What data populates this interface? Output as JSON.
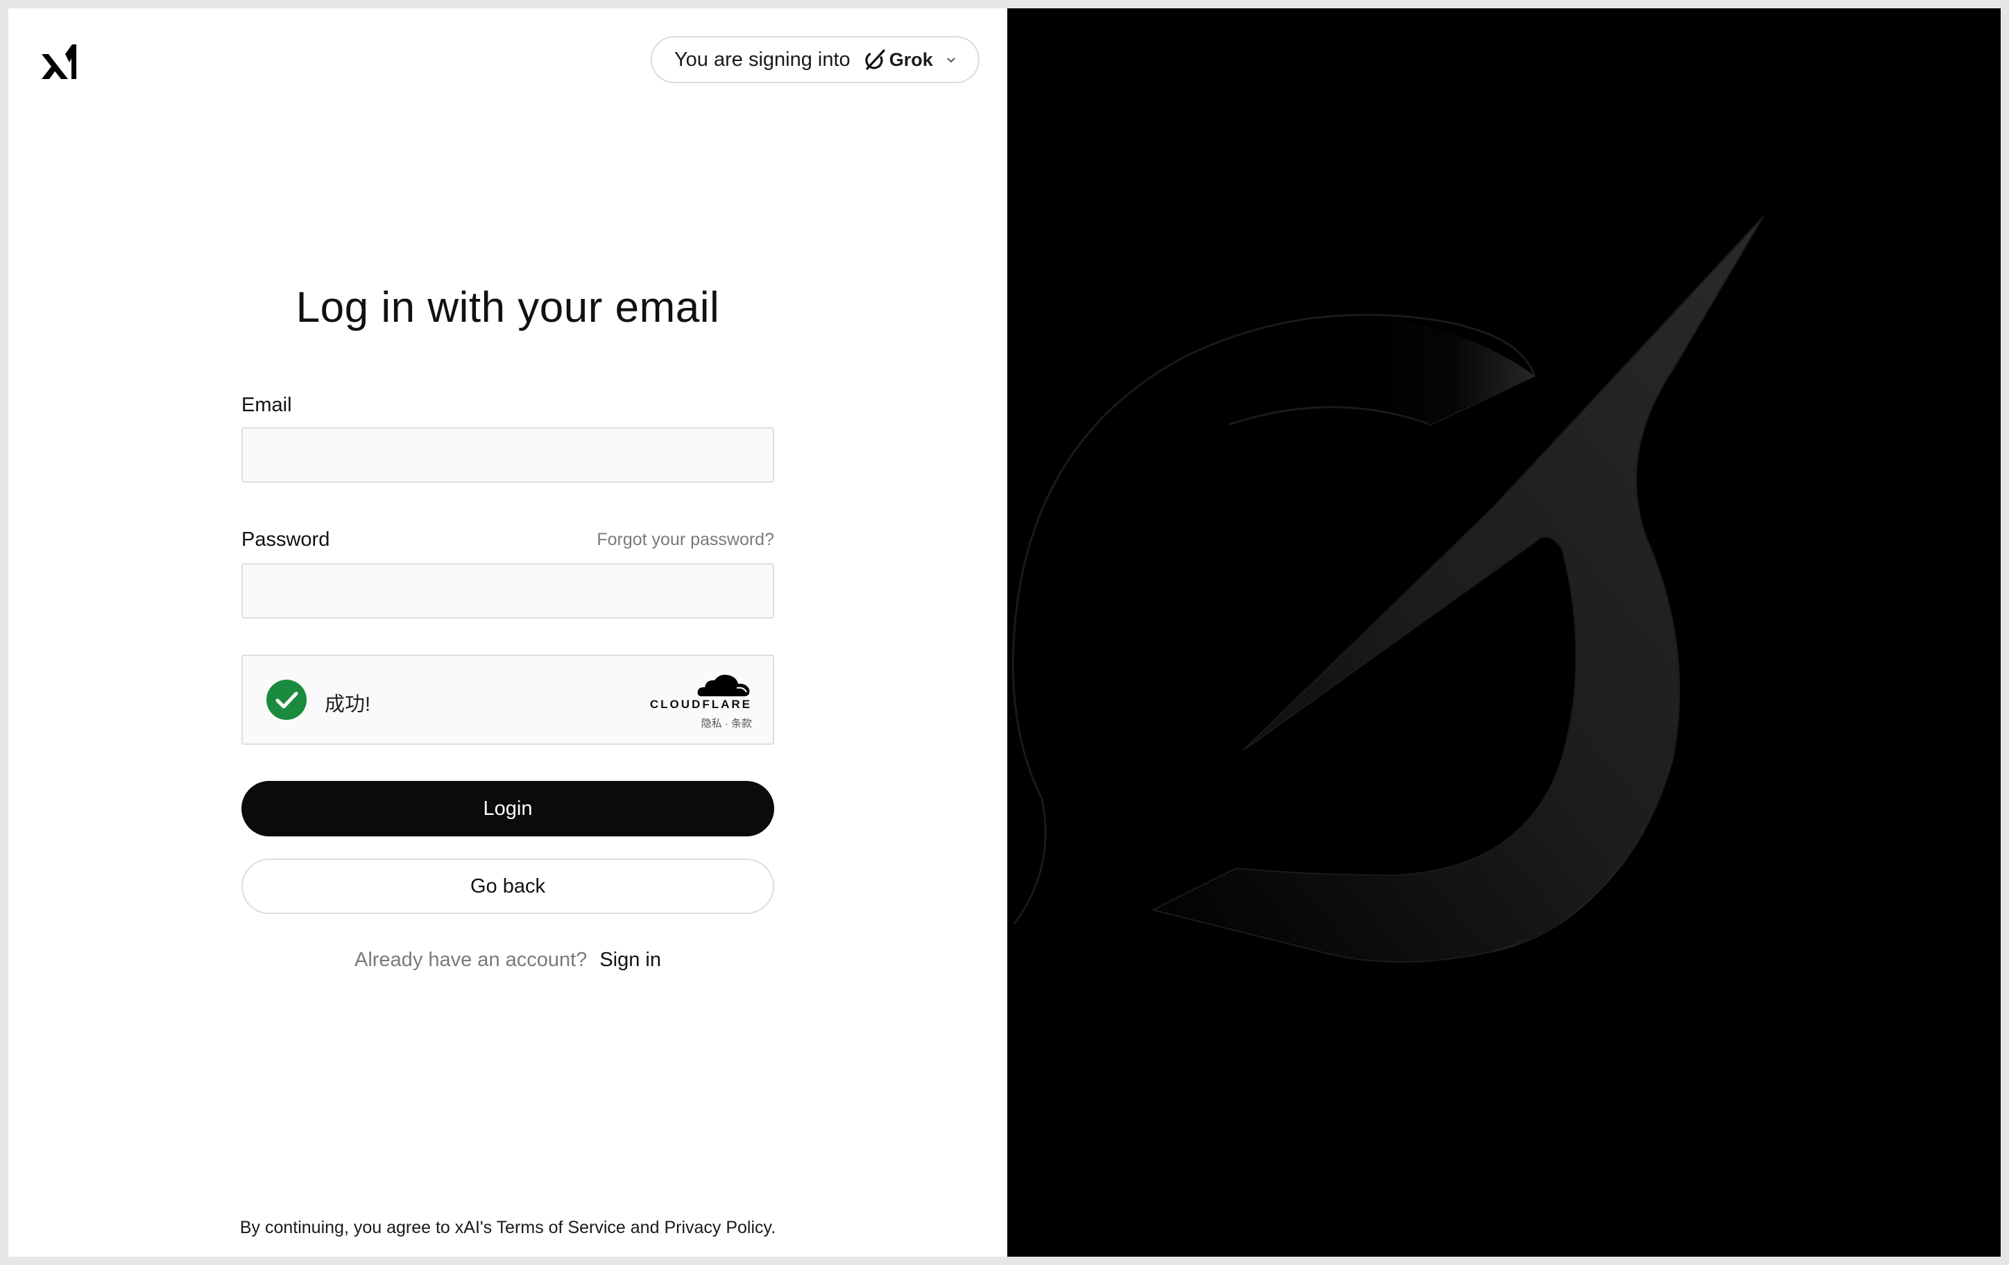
{
  "header": {
    "logo": "xai-logo",
    "signing_prefix": "You are signing into",
    "product_name": "Grok",
    "product_icon": "grok-icon",
    "dropdown_icon": "chevron-down-icon"
  },
  "form": {
    "title": "Log in with your email",
    "email_label": "Email",
    "email_value": "",
    "password_label": "Password",
    "password_value": "",
    "forgot_link": "Forgot your password?",
    "captcha": {
      "status_text": "成功!",
      "provider": "CLOUDFLARE",
      "links": "隐私 · 条款",
      "status_color": "#1a8b3e"
    },
    "login_button": "Login",
    "back_button": "Go back",
    "account_question": "Already have an account?",
    "sign_in_link": "Sign in"
  },
  "footer": {
    "prefix": "By continuing, you agree to xAI's ",
    "terms": "Terms of Service",
    "conjunction": " and ",
    "privacy": "Privacy Policy",
    "suffix": "."
  },
  "colors": {
    "primary_button": "#0b0b0b",
    "right_panel": "#000000",
    "muted_text": "#7a7a7a"
  }
}
